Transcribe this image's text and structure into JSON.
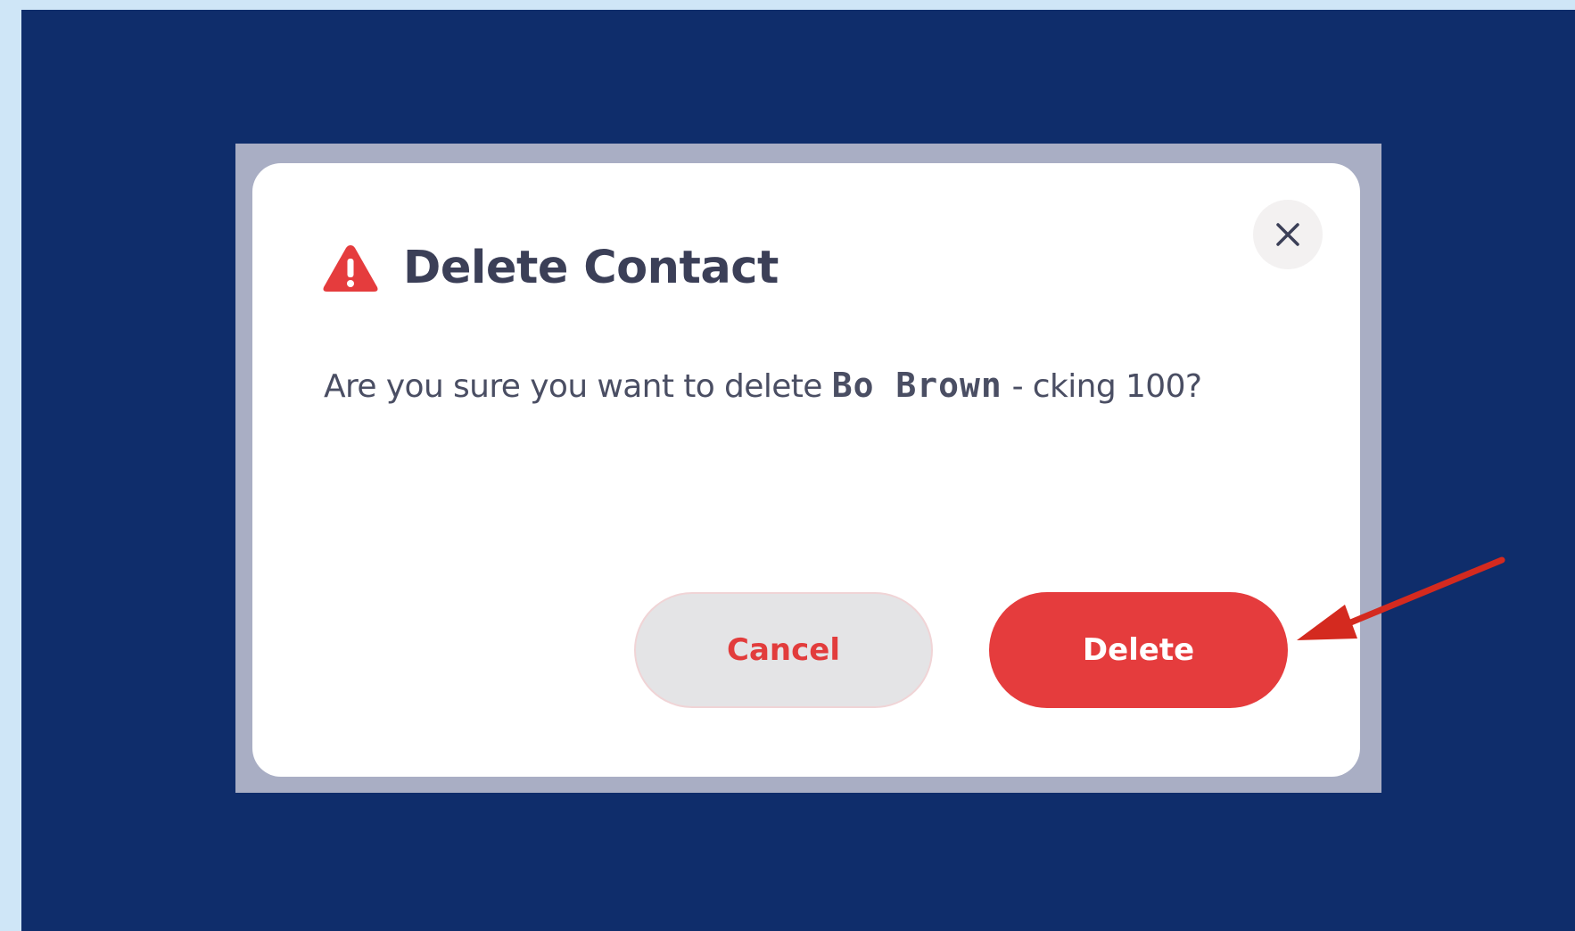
{
  "dialog": {
    "title": "Delete Contact",
    "message_prefix": "Are you sure you want to delete ",
    "contact_name": "Bo Brown",
    "message_suffix": " - cking 100?",
    "cancel_label": "Cancel",
    "delete_label": "Delete",
    "close_symbol": "×"
  },
  "icons": {
    "title_icon": "warning-triangle-icon",
    "close_icon": "close-icon"
  },
  "colors": {
    "backdrop": "#0f2d6b",
    "page_edge": "#cfe6f7",
    "danger": "#e53c3d",
    "title_text": "#3b3f57",
    "annotation_arrow": "#d42a1f"
  }
}
